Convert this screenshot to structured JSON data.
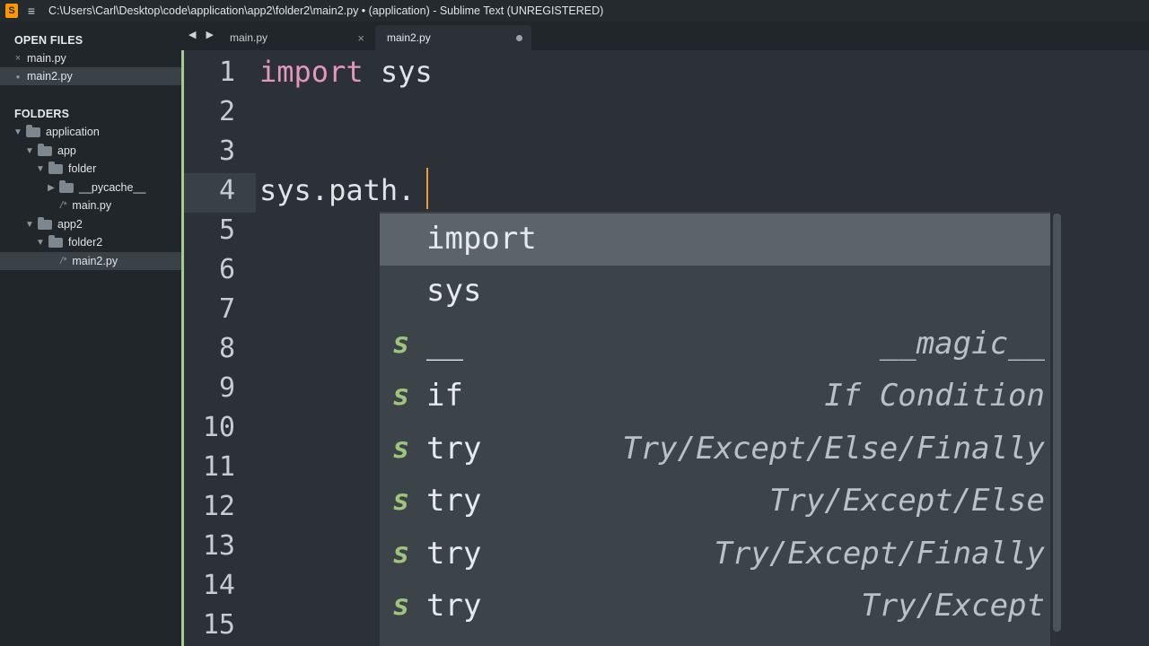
{
  "window": {
    "title": "C:\\Users\\Carl\\Desktop\\code\\application\\app2\\folder2\\main2.py • (application) - Sublime Text (UNREGISTERED)",
    "app_icon": "S",
    "menu_icon": "≡"
  },
  "sidebar": {
    "open_files_header": "OPEN FILES",
    "open_files": [
      {
        "mark": "×",
        "label": "main.py"
      },
      {
        "mark": "●",
        "label": "main2.py"
      }
    ],
    "folders_header": "FOLDERS",
    "tree": [
      {
        "arrow": "▼",
        "label": "application"
      },
      {
        "arrow": "▼",
        "label": "app"
      },
      {
        "arrow": "▼",
        "label": "folder"
      },
      {
        "arrow": "▶",
        "label": "__pycache__"
      },
      {
        "icon": "/*",
        "label": "main.py"
      },
      {
        "arrow": "▼",
        "label": "app2"
      },
      {
        "arrow": "▼",
        "label": "folder2"
      },
      {
        "icon": "/*",
        "label": "main2.py"
      }
    ]
  },
  "tabs": {
    "nav": "◀ ▶",
    "items": [
      {
        "label": "main.py",
        "close": "×"
      },
      {
        "label": "main2.py"
      }
    ]
  },
  "editor": {
    "line_numbers": [
      "1",
      "2",
      "3",
      "4",
      "5",
      "6",
      "7",
      "8",
      "9",
      "10",
      "11",
      "12",
      "13",
      "14",
      "15"
    ],
    "line1_keyword": "import",
    "line1_rest": " sys",
    "line4": "sys.path."
  },
  "autocomplete": {
    "kind_letter": "s",
    "items": [
      {
        "trigger": "import",
        "annotation": ""
      },
      {
        "trigger": "sys",
        "annotation": ""
      },
      {
        "trigger": "__",
        "annotation": "__magic__"
      },
      {
        "trigger": "if",
        "annotation": "If Condition"
      },
      {
        "trigger": "try",
        "annotation": "Try/Except/Else/Finally"
      },
      {
        "trigger": "try",
        "annotation": "Try/Except/Else"
      },
      {
        "trigger": "try",
        "annotation": "Try/Except/Finally"
      },
      {
        "trigger": "try",
        "annotation": "Try/Except"
      }
    ]
  },
  "colors": {
    "keyword": "#e596c0",
    "snippet_kind": "#9ec57b",
    "caret": "#f29b3a"
  }
}
